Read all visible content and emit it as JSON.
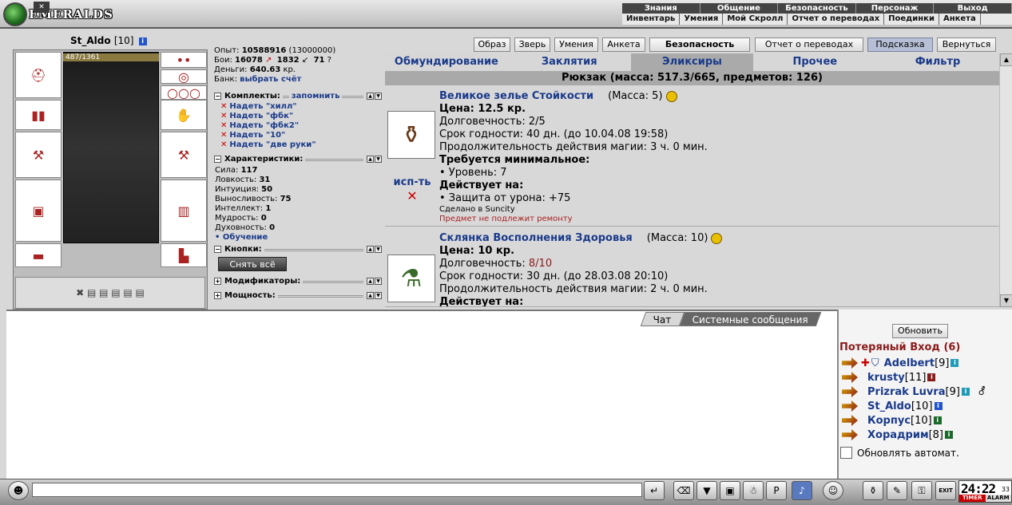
{
  "topbar": {
    "logo": "EMERALDS",
    "row1": [
      "Знания",
      "Общение",
      "Безопасность",
      "Персонаж",
      "Выход"
    ],
    "row2": [
      "Инвентарь",
      "Умения",
      "Мой Скролл",
      "Отчет о переводах",
      "Поединки",
      "Анкета"
    ]
  },
  "character": {
    "name": "St_Aldo",
    "level": "[10]",
    "hp": "487/1361"
  },
  "stats": {
    "exp_label": "Опыт:",
    "exp": "10588916",
    "exp_next": "(13000000)",
    "fights_label": "Бои:",
    "fights_win": "16078",
    "fights_loss": "1832",
    "fights_draw": "71",
    "money_label": "Деньги:",
    "money": "640.63",
    "money_unit": "кр.",
    "bank_label": "Банк:",
    "bank_link": "выбрать счёт"
  },
  "sections": {
    "kits": "Комплекты:",
    "kits_remember": "запомнить",
    "chars": "Характеристики:",
    "buttons": "Кнопки:",
    "mods": "Модификаторы:",
    "power": "Мощность:"
  },
  "kits": [
    "Надеть \"хилл\"",
    "Надеть \"фбк\"",
    "Надеть \"фбк2\"",
    "Надеть \"10\"",
    "Надеть \"две руки\""
  ],
  "attributes": [
    {
      "label": "Сила:",
      "value": "117"
    },
    {
      "label": "Ловкость:",
      "value": "31"
    },
    {
      "label": "Интуиция:",
      "value": "50"
    },
    {
      "label": "Выносливость:",
      "value": "75"
    },
    {
      "label": "Интеллект:",
      "value": "1"
    },
    {
      "label": "Мудрость:",
      "value": "0"
    },
    {
      "label": "Духовность:",
      "value": "0"
    }
  ],
  "training_link": "Обучение",
  "remove_all": "Снять всё",
  "top_buttons": [
    "Образ",
    "Зверь",
    "Умения",
    "Анкета",
    "Безопасность",
    "Отчет о переводах",
    "Подсказка",
    "Вернуться"
  ],
  "inv_tabs": [
    "Обмундирование",
    "Заклятия",
    "Эликсиры",
    "Прочее",
    "Фильтр"
  ],
  "backpack": "Рюкзак (масса: 517.3/665, предметов: 126)",
  "items": [
    {
      "name": "Великое зелье Стойкости",
      "mass": "(Масса: 5)",
      "price": "Цена: 12.5 кр.",
      "durability_label": "Долговечность:",
      "durability": "2/5",
      "expiry": "Срок годности: 40 дн. (до 10.04.08 19:58)",
      "duration": "Продолжительность действия магии: 3 ч. 0 мин.",
      "req_title": "Требуется минимальное:",
      "req": "• Уровень: 7",
      "effect_title": "Действует на:",
      "effect": "• Защита от урона: +75",
      "made": "Сделано в Suncity",
      "norepair": "Предмет не подлежит ремонту"
    },
    {
      "name": "Склянка Восполнения Здоровья",
      "mass": "(Масса: 10)",
      "price": "Цена: 10 кр.",
      "durability_label": "Долговечность:",
      "durability": "8/10",
      "expiry": "Срок годности: 30 дн. (до 28.03.08 20:10)",
      "duration": "Продолжительность действия магии: 2 ч. 0 мин.",
      "effect_title": "Действует на:"
    }
  ],
  "use_label": "исп-ть",
  "chat_tabs": [
    "Чат",
    "Системные сообщения"
  ],
  "players_panel": {
    "refresh": "Обновить",
    "location": "Потеряный Вход (6)",
    "players": [
      {
        "name": "Adelbert",
        "level": "[9]"
      },
      {
        "name": "krusty",
        "level": "[11]"
      },
      {
        "name": "Prizrak Luvra",
        "level": "[9]"
      },
      {
        "name": "St_Aldo",
        "level": "[10]"
      },
      {
        "name": "Корпус",
        "level": "[10]"
      },
      {
        "name": "Хорадрим",
        "level": "[8]"
      }
    ],
    "auto_refresh": "Обновлять автомат."
  },
  "clock": {
    "time": "24:22",
    "sec": "33",
    "timer": "TIMER",
    "alarm": "ALARM"
  }
}
